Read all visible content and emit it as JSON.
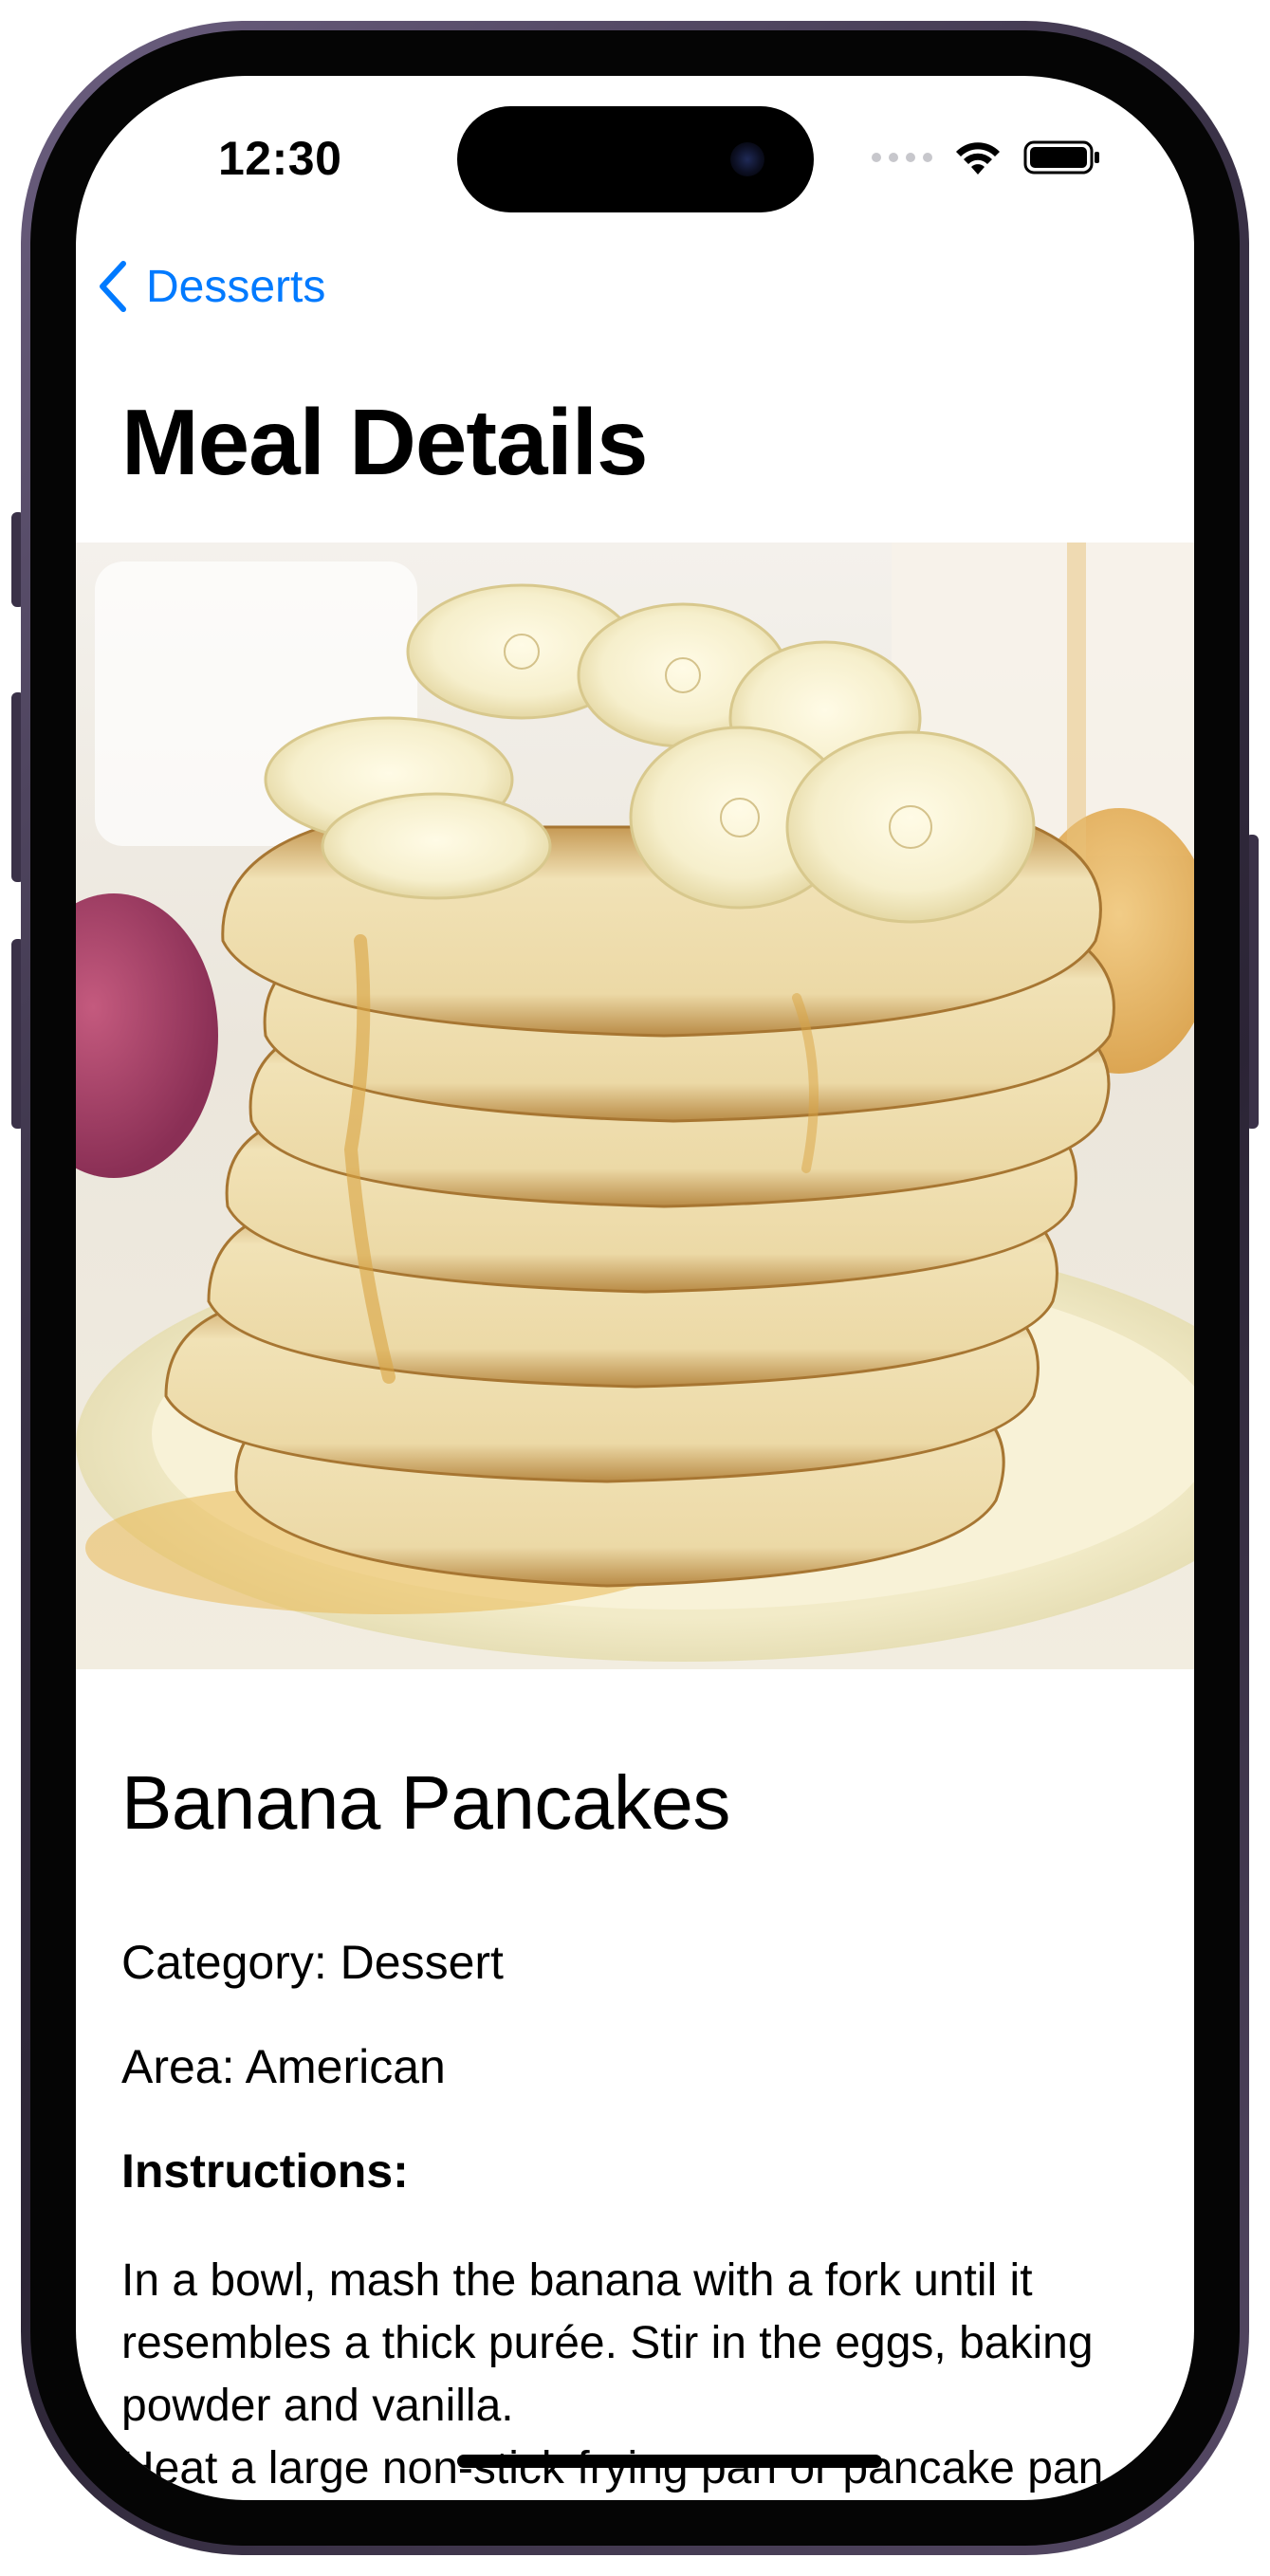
{
  "status_bar": {
    "time": "12:30",
    "icons": [
      "cellular-signal-icon",
      "wifi-icon",
      "battery-icon"
    ]
  },
  "nav": {
    "back_label": "Desserts",
    "back_icon": "chevron-left-icon",
    "title": "Meal Details"
  },
  "meal": {
    "image_icon": "meal-photo",
    "name": "Banana Pancakes",
    "category": "Category: Dessert",
    "area": "Area: American",
    "instructions_heading": "Instructions:",
    "instructions": "In a bowl, mash the banana with a fork until it resembles a thick purée. Stir in the eggs, baking powder and vanilla.\nHeat a large non-stick frying pan or pancake pan over a medium heat and brush with half the"
  },
  "colors": {
    "accent": "#007aff",
    "frame": "#3a3247",
    "background": "#ffffff",
    "text": "#000000"
  }
}
